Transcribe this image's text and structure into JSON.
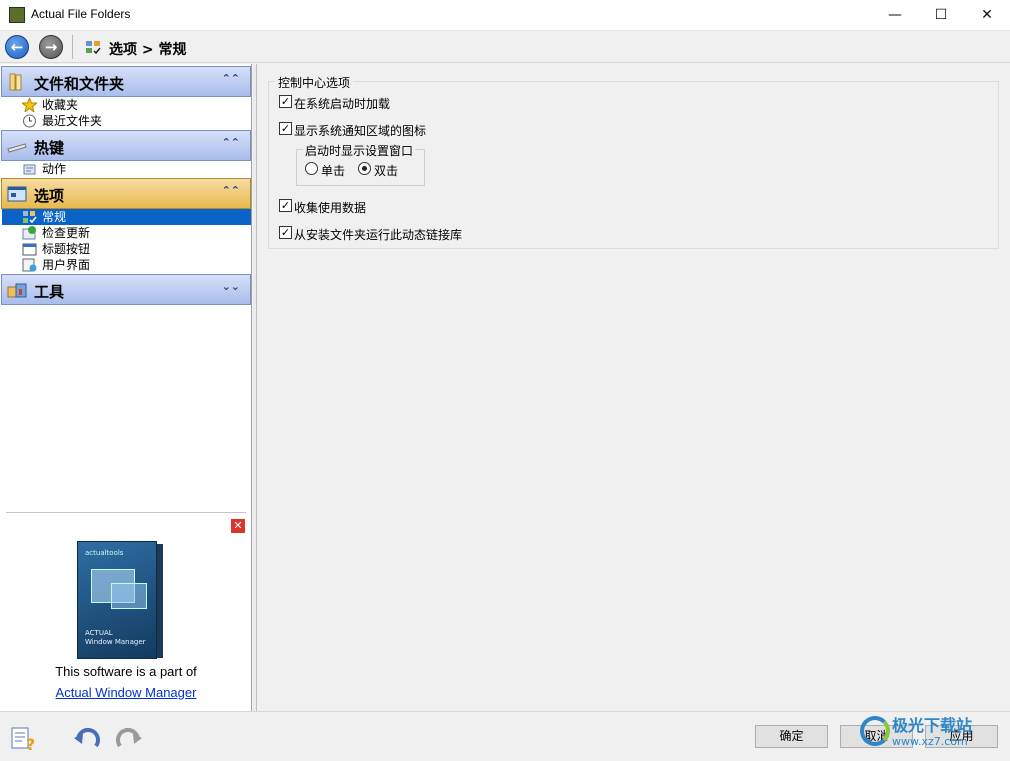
{
  "window": {
    "title": "Actual File Folders",
    "minimize": "—",
    "maximize": "☐",
    "close": "✕"
  },
  "nav": {
    "back": "←",
    "forward": "→",
    "breadcrumb": "选项 > 常规"
  },
  "sidebar": {
    "sections": [
      {
        "label": "文件和文件夹",
        "chevron": "⌃⌃",
        "items": [
          "收藏夹",
          "最近文件夹"
        ]
      },
      {
        "label": "热键",
        "chevron": "⌃⌃",
        "items": [
          "动作"
        ]
      },
      {
        "label": "选项",
        "chevron": "⌃⌃",
        "items": [
          "常规",
          "检查更新",
          "标题按钮",
          "用户界面"
        ]
      },
      {
        "label": "工具",
        "chevron": "⌄⌄",
        "items": []
      }
    ],
    "selected_item": "常规"
  },
  "ad": {
    "close": "✕",
    "box_logo": "actualtools",
    "box_brand_small": "ACTUAL",
    "box_brand": "Window Manager",
    "text": "This software is a part of",
    "link": "Actual Window Manager"
  },
  "settings": {
    "group_title": "控制中心选项",
    "load_on_startup": {
      "label": "在系统启动时加载",
      "checked": true
    },
    "show_tray_icon": {
      "label": "显示系统通知区域的图标",
      "checked": true
    },
    "subgroup_title": "启动时显示设置窗口",
    "radio_single": {
      "label": "单击",
      "selected": false
    },
    "radio_double": {
      "label": "双击",
      "selected": true
    },
    "collect_usage": {
      "label": "收集使用数据",
      "checked": true
    },
    "run_dll": {
      "label": "从安装文件夹运行此动态链接库",
      "checked": true
    }
  },
  "footer": {
    "ok": "确定",
    "cancel": "取消",
    "apply": "应用"
  },
  "watermark": {
    "main": "极光下载站",
    "sub": "www.xz7.com"
  },
  "colors": {
    "selection": "#0a64c8",
    "section_header": "#a9bdec",
    "active_header": "#e8b94f",
    "link": "#0033cc"
  }
}
